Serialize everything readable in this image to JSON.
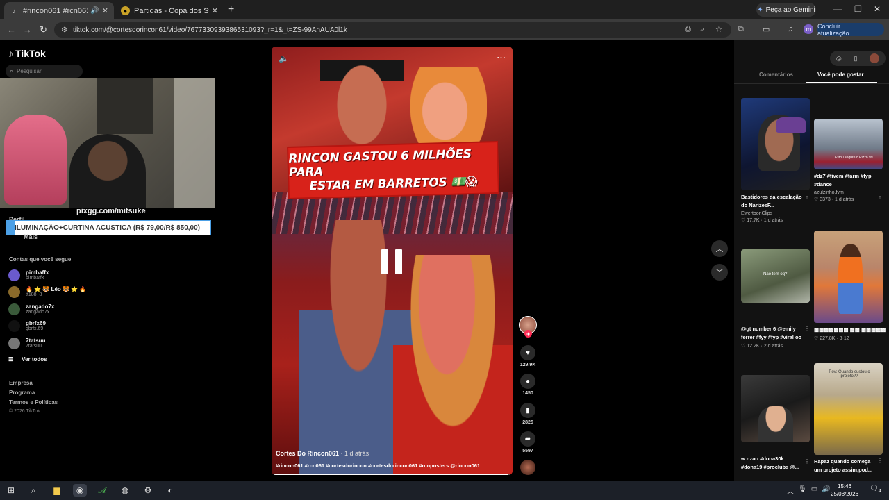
{
  "browser": {
    "tabs": [
      {
        "title": "#rincon061 #rcn061 #corte",
        "active": true
      },
      {
        "title": "Partidas - Copa dos Streamers",
        "active": false
      }
    ],
    "gemini_label": "Peça ao Gemini",
    "url": "tiktok.com/@cortesdorincon61/video/7677330939386531093?_r=1&_t=ZS-99AhAUA0l1k",
    "profile_initial": "m",
    "update_label": "Concluir atualização"
  },
  "sidebar": {
    "logo_text": "TikTok",
    "search_placeholder": "Pesquisar",
    "overlay_url": "pixgg.com/mitsuke",
    "donation_goal": "ILUMINAÇÃO+CURTINA ACUSTICA (R$ 79,00/R$ 850,00)",
    "menu": [
      "Perfil",
      "Mais"
    ],
    "following_title": "Contas que você segue",
    "accounts": [
      {
        "name": "pimbaffx",
        "user": "pimbaffx"
      },
      {
        "name": "🔥 ⭐ 🐯 Léo 🐯 ⭐ 🔥",
        "user": "tt188_8"
      },
      {
        "name": "zangado7x",
        "user": "zangado7x"
      },
      {
        "name": "gbrfx69",
        "user": "gbrfx.69"
      },
      {
        "name": "7tatsuu",
        "user": "7tatsuu"
      }
    ],
    "see_all": "Ver todos",
    "footer": [
      "Empresa",
      "Programa",
      "Termos e Políticas"
    ],
    "copyright": "© 2026 TikTok"
  },
  "video": {
    "banner_line1": "RINCON GASTOU 6 MILHÕES PARA",
    "banner_line2": "ESTAR EM BARRETOS 💵😱",
    "author": "Cortes Do Rincon061",
    "posted": "· 1 d atrás",
    "caption": "#rincon061 #rcn061 #cortesdorincon #cortesdorincon061 #rcnposters @rincon061",
    "progress": 0.98,
    "likes": "129.9K",
    "comments": "1450",
    "saves": "2825",
    "shares": "5597"
  },
  "right_panel": {
    "tabs": [
      "Comentários",
      "Você pode gostar"
    ],
    "cards": [
      {
        "caption": "Bastidores da escalação do NarizesF...",
        "author": "EwertoonClips",
        "likes": "17.7K",
        "age": "1 d atrás"
      },
      {
        "caption": "#dz7 #fivem #farm #fyp #dance",
        "author": "azulzinho.fvm",
        "likes": "3373",
        "age": "1 d atrás"
      },
      {
        "caption": "@gt number 6 @emily ferrer #fyy #fyp #viral oo",
        "author": "",
        "likes": "12.2K",
        "age": "2 d atrás"
      },
      {
        "caption": "▩▩▩▩▩▩▩.▩▩.▩▩▩▩▩",
        "author": "",
        "likes": "227.8K",
        "age": "8-12"
      },
      {
        "caption": "w nzao #dona30k #dona19 #proclubs @...",
        "author": "",
        "likes": "",
        "age": ""
      },
      {
        "caption": "Rapaz quando começa um projeto assim,pod...",
        "author": "",
        "likes": "",
        "age": ""
      }
    ],
    "thumb_texts": [
      "Não tem oq?",
      "Pov: Quando custou o projeto??",
      "Estou segure o Rizzo 99"
    ]
  },
  "taskbar": {
    "time": "15:46",
    "date": "25/08/2026",
    "notifications": "4"
  }
}
